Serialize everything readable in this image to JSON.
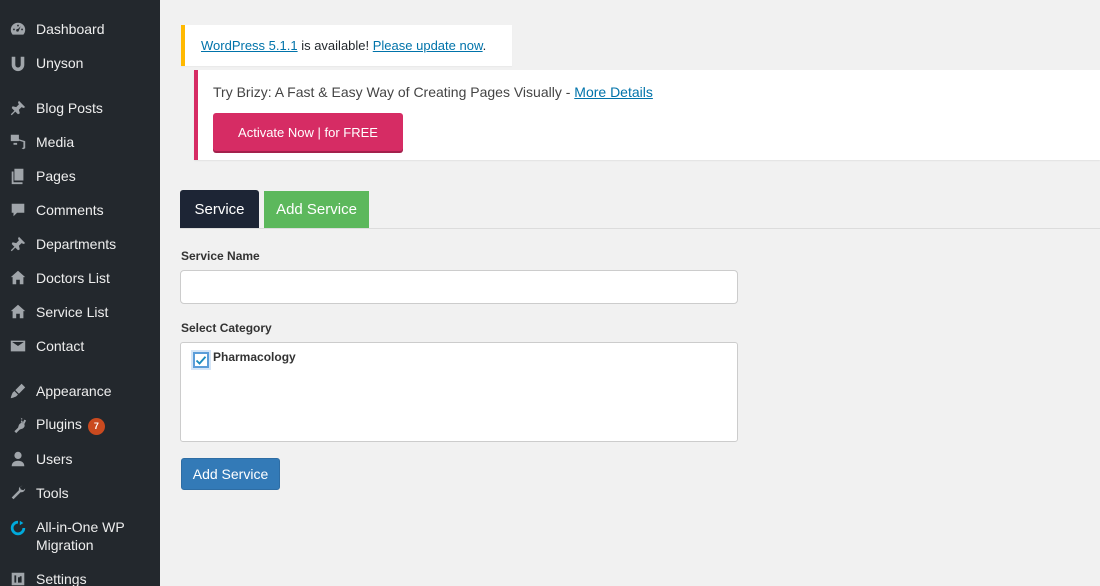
{
  "sidebar": {
    "items": [
      {
        "label": "Dashboard",
        "icon": "dashboard-icon"
      },
      {
        "label": "Unyson",
        "icon": "unyson-icon"
      },
      {
        "label": "Blog Posts",
        "icon": "pin-icon"
      },
      {
        "label": "Media",
        "icon": "media-icon"
      },
      {
        "label": "Pages",
        "icon": "pages-icon"
      },
      {
        "label": "Comments",
        "icon": "comment-icon"
      },
      {
        "label": "Departments",
        "icon": "pin-icon"
      },
      {
        "label": "Doctors List",
        "icon": "home-icon"
      },
      {
        "label": "Service List",
        "icon": "home-icon"
      },
      {
        "label": "Contact",
        "icon": "mail-icon"
      },
      {
        "label": "Appearance",
        "icon": "brush-icon"
      },
      {
        "label": "Plugins",
        "icon": "plugin-icon",
        "badge": "7"
      },
      {
        "label": "Users",
        "icon": "user-icon"
      },
      {
        "label": "Tools",
        "icon": "wrench-icon"
      },
      {
        "label": "All-in-One WP Migration",
        "label_line1": "All-in-One WP",
        "label_line2": "Migration",
        "icon": "migration-icon"
      },
      {
        "label": "Settings",
        "icon": "settings-icon"
      }
    ]
  },
  "notices": {
    "update": {
      "link1": "WordPress 5.1.1",
      "middle": " is available! ",
      "link2": "Please update now",
      "end": "."
    },
    "brizy": {
      "text": "Try Brizy: A Fast & Easy Way of Creating Pages Visually - ",
      "link": "More Details",
      "button": "Activate Now | for FREE"
    }
  },
  "tabs": {
    "service": "Service",
    "add_service": "Add Service"
  },
  "form": {
    "service_name_label": "Service Name",
    "service_name_value": "",
    "select_category_label": "Select Category",
    "categories": [
      {
        "label": "Pharmacology",
        "checked": true
      }
    ],
    "submit_label": "Add Service"
  },
  "colors": {
    "sidebar_bg": "#23282d",
    "update_border": "#ffb900",
    "brizy_accent": "#d62c64",
    "tab_active": "#1d2535",
    "tab_add": "#5cb85c",
    "primary_button": "#337ab7"
  }
}
